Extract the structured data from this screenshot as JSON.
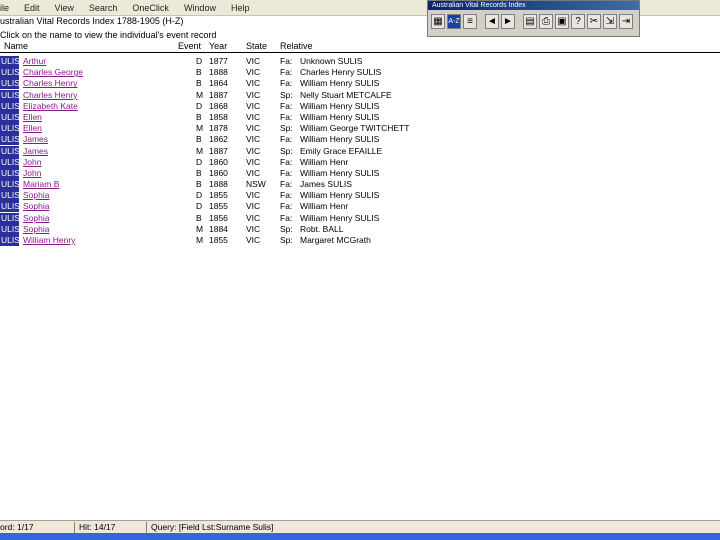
{
  "menu": [
    "ile",
    "Edit",
    "View",
    "Search",
    "OneClick",
    "Window",
    "Help"
  ],
  "toolbar": {
    "title": "Australian Vital Records Index",
    "sort_label": "A-Z"
  },
  "title": "ustralian Vital Records Index 1788-1905 (H-Z)",
  "instruction": "Click on the name to view the individual's event record",
  "columns": {
    "name": "Name",
    "event": "Event",
    "year": "Year",
    "state": "State",
    "relative": "Relative"
  },
  "rows": [
    {
      "surname": "ULIS",
      "given": "Arthur",
      "event": "D",
      "year": "1877",
      "state": "VIC",
      "rel": "Fa:",
      "relname": "Unknown SULIS"
    },
    {
      "surname": "ULIS",
      "given": "Charles George",
      "event": "B",
      "year": "1888",
      "state": "VIC",
      "rel": "Fa:",
      "relname": "Charles Henry SULIS"
    },
    {
      "surname": "ULIS",
      "given": "Charles Henry",
      "event": "B",
      "year": "1864",
      "state": "VIC",
      "rel": "Fa:",
      "relname": "William Henry SULIS"
    },
    {
      "surname": "ULIS",
      "given": "Charles Henry",
      "event": "M",
      "year": "1887",
      "state": "VIC",
      "rel": "Sp:",
      "relname": "Nelly Stuart METCALFE"
    },
    {
      "surname": "ULIS",
      "given": "Elizabeth Kate",
      "event": "D",
      "year": "1868",
      "state": "VIC",
      "rel": "Fa:",
      "relname": "William Henry SULIS"
    },
    {
      "surname": "ULIS",
      "given": "Ellen",
      "event": "B",
      "year": "1858",
      "state": "VIC",
      "rel": "Fa:",
      "relname": "William Henry SULIS"
    },
    {
      "surname": "ULIS",
      "given": "Ellen",
      "event": "M",
      "year": "1878",
      "state": "VIC",
      "rel": "Sp:",
      "relname": "William George TWITCHETT"
    },
    {
      "surname": "ULIS",
      "given": "James",
      "event": "B",
      "year": "1862",
      "state": "VIC",
      "rel": "Fa:",
      "relname": "William Henry SULIS"
    },
    {
      "surname": "ULIS",
      "given": "James",
      "event": "M",
      "year": "1887",
      "state": "VIC",
      "rel": "Sp:",
      "relname": "Emily Grace EFAILLE"
    },
    {
      "surname": "ULIS",
      "given": "John",
      "event": "D",
      "year": "1860",
      "state": "VIC",
      "rel": "Fa:",
      "relname": "William Henr"
    },
    {
      "surname": "ULIS",
      "given": "John",
      "event": "B",
      "year": "1860",
      "state": "VIC",
      "rel": "Fa:",
      "relname": "William Henry SULIS"
    },
    {
      "surname": "ULIS",
      "given": "Mariam B",
      "event": "B",
      "year": "1888",
      "state": "NSW",
      "rel": "Fa:",
      "relname": "James SULIS"
    },
    {
      "surname": "ULIS",
      "given": "Sophia",
      "event": "D",
      "year": "1855",
      "state": "VIC",
      "rel": "Fa:",
      "relname": "William Henry SULIS"
    },
    {
      "surname": "ULIS",
      "given": "Sophia",
      "event": "D",
      "year": "1855",
      "state": "VIC",
      "rel": "Fa:",
      "relname": "William Henr"
    },
    {
      "surname": "ULIS",
      "given": "Sophia",
      "event": "B",
      "year": "1856",
      "state": "VIC",
      "rel": "Fa:",
      "relname": "William Henry SULIS"
    },
    {
      "surname": "ULIS",
      "given": "Sophia",
      "event": "M",
      "year": "1884",
      "state": "VIC",
      "rel": "Sp:",
      "relname": "Robt. BALL"
    },
    {
      "surname": "ULIS",
      "given": "William Henry",
      "event": "M",
      "year": "1855",
      "state": "VIC",
      "rel": "Sp:",
      "relname": "Margaret MCGrath"
    }
  ],
  "status": {
    "record": "ord: 1/17",
    "hit": "Hit: 14/17",
    "query": "Query: [Field Lst:Surname Sulis]"
  }
}
